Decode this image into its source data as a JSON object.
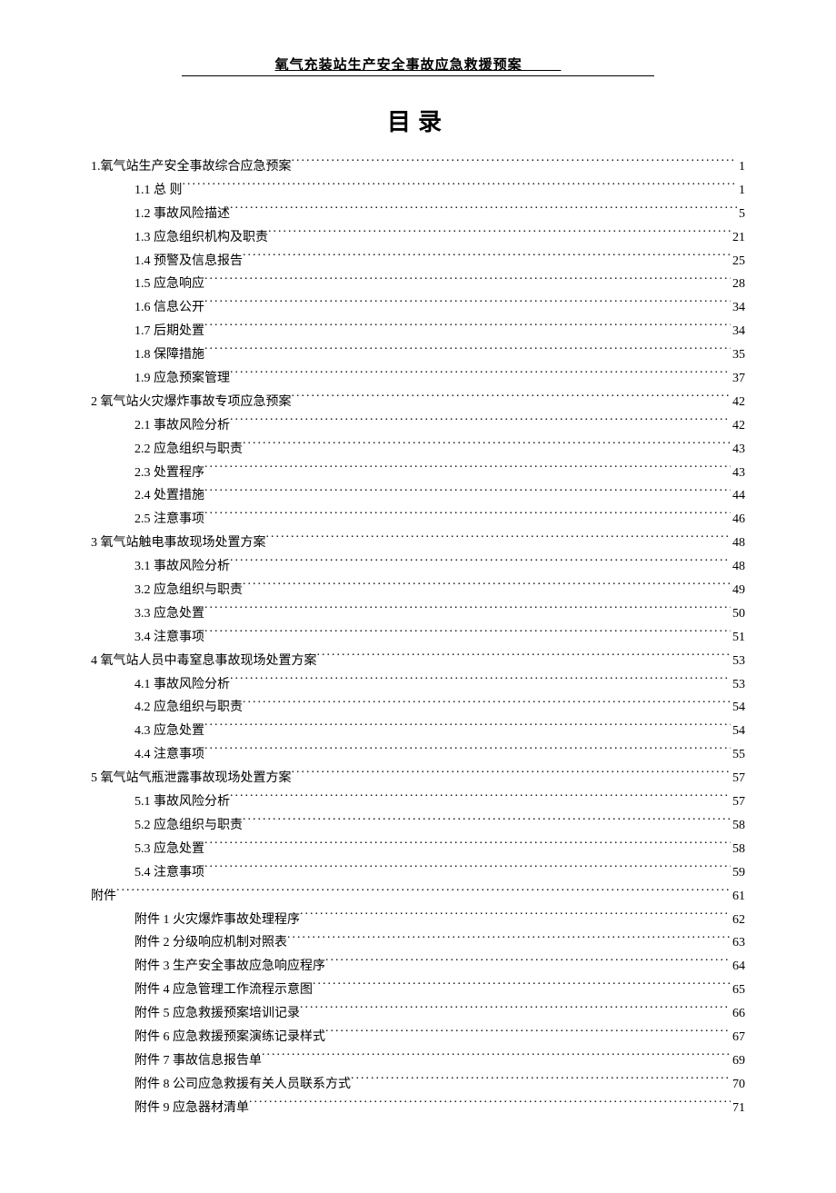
{
  "header_title": "氧气充装站生产安全事故应急救援预案         ",
  "toc_title": "目录",
  "toc": [
    {
      "level": 1,
      "label": "1.氧气站生产安全事故综合应急预案",
      "page": "1"
    },
    {
      "level": 2,
      "label": "1.1  总    则",
      "page": "1"
    },
    {
      "level": 2,
      "label": "1.2 事故风险描述",
      "page": "5"
    },
    {
      "level": 2,
      "label": "1.3  应急组织机构及职责",
      "page": "21"
    },
    {
      "level": 2,
      "label": "1.4 预警及信息报告",
      "page": "25"
    },
    {
      "level": 2,
      "label": "1.5  应急响应",
      "page": "28"
    },
    {
      "level": 2,
      "label": "1.6  信息公开",
      "page": "34"
    },
    {
      "level": 2,
      "label": "1.7  后期处置",
      "page": "34"
    },
    {
      "level": 2,
      "label": "1.8 保障措施",
      "page": "35"
    },
    {
      "level": 2,
      "label": "1.9 应急预案管理",
      "page": "37"
    },
    {
      "level": 1,
      "label": "2 氧气站火灾爆炸事故专项应急预案",
      "page": "42"
    },
    {
      "level": 2,
      "label": "2.1 事故风险分析",
      "page": "42"
    },
    {
      "level": 2,
      "label": "2.2 应急组织与职责",
      "page": "43"
    },
    {
      "level": 2,
      "label": "2.3 处置程序",
      "page": "43"
    },
    {
      "level": 2,
      "label": "2.4 处置措施",
      "page": "44"
    },
    {
      "level": 2,
      "label": "2.5 注意事项",
      "page": "46"
    },
    {
      "level": 1,
      "label": "3 氧气站触电事故现场处置方案",
      "page": "48"
    },
    {
      "level": 2,
      "label": "3.1 事故风险分析",
      "page": "48"
    },
    {
      "level": 2,
      "label": "3.2 应急组织与职责",
      "page": "49"
    },
    {
      "level": 2,
      "label": "3.3 应急处置",
      "page": "50"
    },
    {
      "level": 2,
      "label": "3.4 注意事项",
      "page": "51"
    },
    {
      "level": 1,
      "label": "4 氧气站人员中毒窒息事故现场处置方案",
      "page": "53"
    },
    {
      "level": 2,
      "label": "4.1 事故风险分析",
      "page": "53"
    },
    {
      "level": 2,
      "label": "4.2 应急组织与职责",
      "page": "54"
    },
    {
      "level": 2,
      "label": "4.3 应急处置",
      "page": "54"
    },
    {
      "level": 2,
      "label": "4.4 注意事项",
      "page": "55"
    },
    {
      "level": 1,
      "label": "5 氧气站气瓶泄露事故现场处置方案",
      "page": "57"
    },
    {
      "level": 2,
      "label": "5.1 事故风险分析",
      "page": "57"
    },
    {
      "level": 2,
      "label": "5.2 应急组织与职责",
      "page": "58"
    },
    {
      "level": 2,
      "label": "5.3 应急处置",
      "page": "58"
    },
    {
      "level": 2,
      "label": "5.4 注意事项",
      "page": "59"
    },
    {
      "level": 1,
      "label": "附件",
      "page": "61"
    },
    {
      "level": 2,
      "label": "附件 1 火灾爆炸事故处理程序",
      "page": "62"
    },
    {
      "level": 2,
      "label": "附件 2 分级响应机制对照表",
      "page": "63"
    },
    {
      "level": 2,
      "label": "附件 3 生产安全事故应急响应程序",
      "page": "64"
    },
    {
      "level": 2,
      "label": "附件 4 应急管理工作流程示意图",
      "page": "65"
    },
    {
      "level": 2,
      "label": "附件 5 应急救援预案培训记录",
      "page": "66"
    },
    {
      "level": 2,
      "label": "附件 6 应急救援预案演练记录样式",
      "page": "67"
    },
    {
      "level": 2,
      "label": "附件 7 事故信息报告单",
      "page": "69"
    },
    {
      "level": 2,
      "label": "附件 8 公司应急救援有关人员联系方式",
      "page": "70"
    },
    {
      "level": 2,
      "label": "附件 9 应急器材清单",
      "page": "71"
    }
  ]
}
